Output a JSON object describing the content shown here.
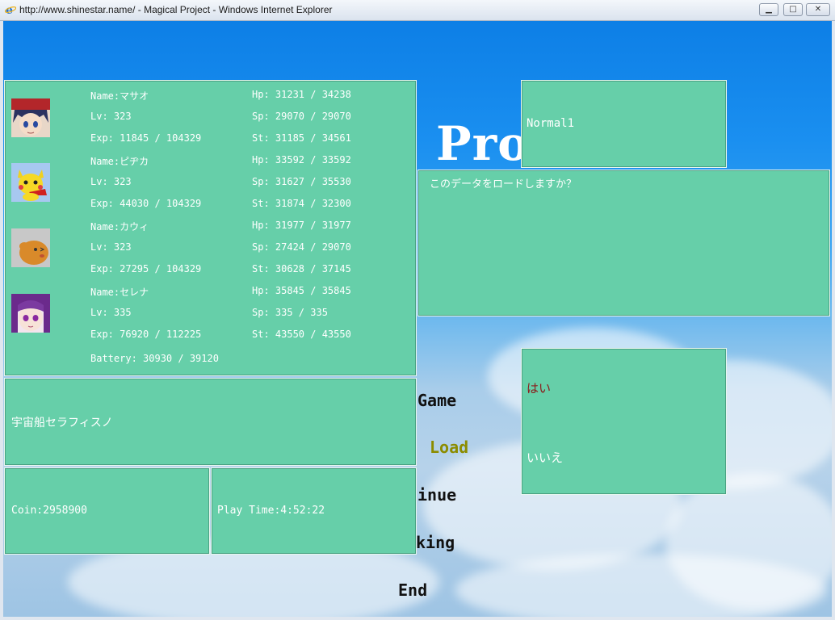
{
  "window": {
    "title": "http://www.shinestar.name/ - Magical Project - Windows Internet Explorer",
    "icon": "ie-icon",
    "buttons": [
      "minimize",
      "maximize",
      "close"
    ]
  },
  "background_title": "Pro",
  "party": [
    {
      "name": "Name:マサオ",
      "lv": "Lv:  323",
      "exp": "Exp: 11845 / 104329",
      "hp": "Hp:  31231 / 34238",
      "sp": "Sp:  29070 / 29070",
      "st": "St:  31185 / 34561",
      "portrait": "masao-portrait"
    },
    {
      "name": "Name:ピヂカ",
      "lv": "Lv:  323",
      "exp": "Exp: 44030 / 104329",
      "hp": "Hp:  33592 / 33592",
      "sp": "Sp:  31627 / 35530",
      "st": "St:  31874 / 32300",
      "portrait": "pidika-portrait"
    },
    {
      "name": "Name:カウィ",
      "lv": "Lv:  323",
      "exp": "Exp: 27295 / 104329",
      "hp": "Hp:  31977 / 31977",
      "sp": "Sp:  27424 / 29070",
      "st": "St:  30628 / 37145",
      "portrait": "kawi-portrait"
    },
    {
      "name": "Name:セレナ",
      "lv": "Lv:  335",
      "exp": "Exp: 76920 / 112225",
      "hp": "Hp:  35845 / 35845",
      "sp": "Sp:  335 / 335",
      "st": "St:  43550 / 43550",
      "portrait": "serena-portrait"
    }
  ],
  "battery": "Battery: 30930 / 39120",
  "location": "宇宙船セラフィスノ",
  "coin": "Coin:2958900",
  "play_time": "Play Time:4:52:22",
  "difficulty": "Normal1",
  "message": "このデータをロードしますか？",
  "confirm": {
    "yes": "はい",
    "no": "いいえ"
  },
  "menu": {
    "new_game": "Game",
    "load": "Load",
    "continue": "inue",
    "ranking": "king",
    "end": "End"
  },
  "colors": {
    "panel": "#66cfa9",
    "selected_menu": "#8c8c00",
    "selected_choice": "#8b1a1a"
  }
}
